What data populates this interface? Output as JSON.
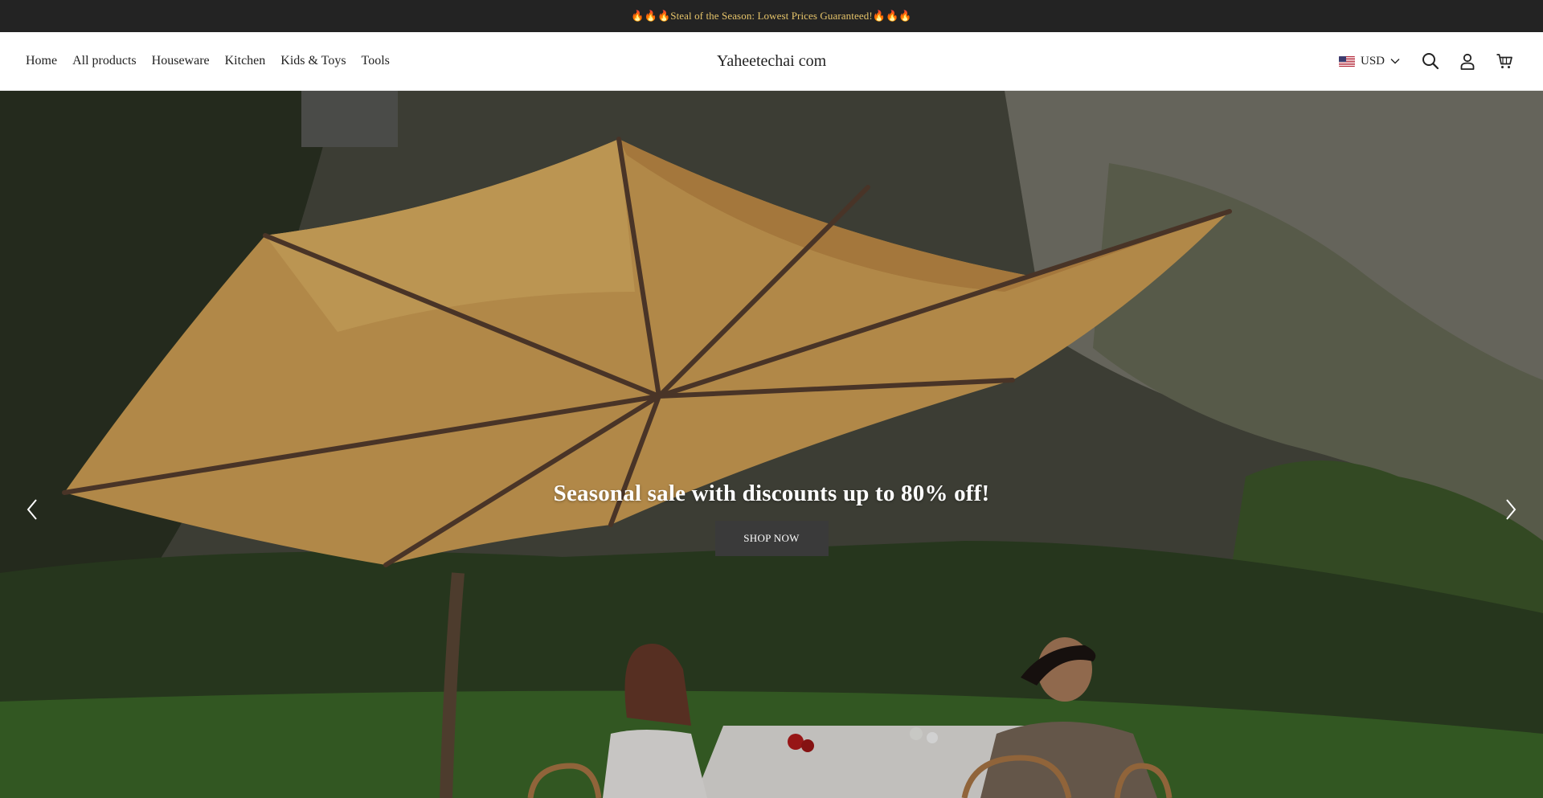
{
  "announcement": {
    "text": "🔥🔥🔥Steal of the Season: Lowest Prices Guaranteed!🔥🔥🔥"
  },
  "nav": {
    "items": [
      {
        "label": "Home"
      },
      {
        "label": "All products"
      },
      {
        "label": "Houseware"
      },
      {
        "label": "Kitchen"
      },
      {
        "label": "Kids & Toys"
      },
      {
        "label": "Tools"
      }
    ]
  },
  "brand": {
    "title": "Yaheetechai com"
  },
  "header_tools": {
    "currency": "USD",
    "icons": [
      "search-icon",
      "account-icon",
      "cart-icon"
    ]
  },
  "hero": {
    "title": "Seasonal sale with discounts up to 80% off!",
    "cta_label": "SHOP NOW"
  },
  "colors": {
    "announcement_bg": "#232323",
    "announcement_text": "#e6c46a",
    "cta_bg": "#3a3a3a",
    "umbrella": "#e0ac5a"
  }
}
